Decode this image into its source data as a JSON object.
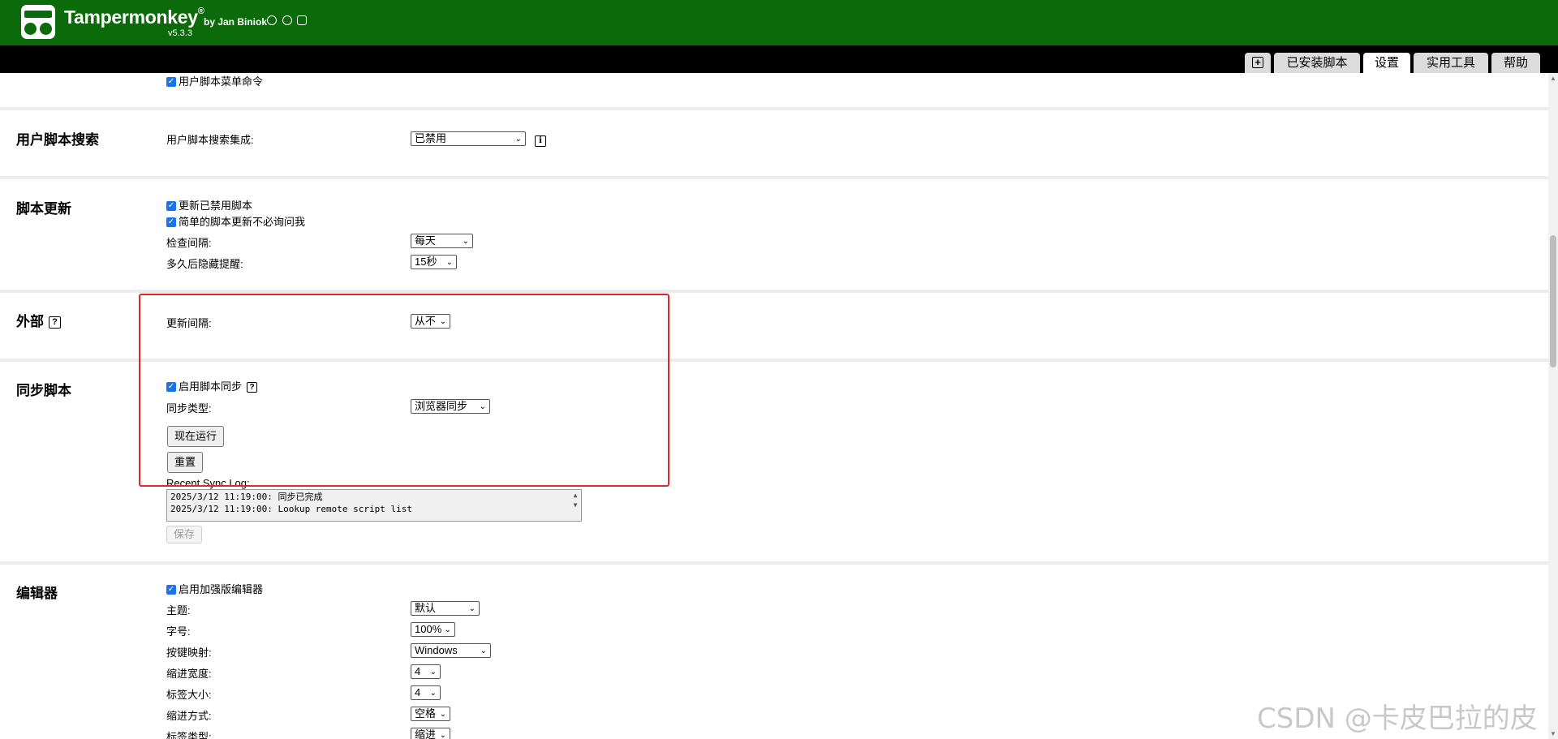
{
  "header": {
    "app_name": "Tampermonkey",
    "reg_mark": "®",
    "byline": "by Jan Biniok",
    "version": "v5.3.3"
  },
  "tabs": {
    "new_icon": "plus-square-icon",
    "installed": "已安装脚本",
    "settings": "设置",
    "utilities": "实用工具",
    "help": "帮助"
  },
  "top_row": {
    "menu_commands": "用户脚本菜单命令"
  },
  "search_section": {
    "title": "用户脚本搜索",
    "integration_label": "用户脚本搜索集成:",
    "integration_value": "已禁用"
  },
  "update_section": {
    "title": "脚本更新",
    "update_disabled": "更新已禁用脚本",
    "dont_ask": "简单的脚本更新不必询问我",
    "check_interval_label": "检查间隔:",
    "check_interval_value": "每天",
    "hide_after_label": "多久后隐藏提醒:",
    "hide_after_value": "15秒"
  },
  "external_section": {
    "title": "外部",
    "interval_label": "更新间隔:",
    "interval_value": "从不"
  },
  "sync_section": {
    "title": "同步脚本",
    "enable_sync": "启用脚本同步",
    "sync_type_label": "同步类型:",
    "sync_type_value": "浏览器同步",
    "run_now": "现在运行",
    "reset": "重置",
    "log_label": "Recent Sync Log:",
    "log_line1": "2025/3/12 11:19:00: 同步已完成",
    "log_line2": "2025/3/12 11:19:00: Lookup remote script list",
    "save": "保存"
  },
  "editor_section": {
    "title": "编辑器",
    "enable_enhanced": "启用加强版编辑器",
    "theme_label": "主题:",
    "theme_value": "默认",
    "font_size_label": "字号:",
    "font_size_value": "100%",
    "keymap_label": "按键映射:",
    "keymap_value": "Windows",
    "indent_width_label": "缩进宽度:",
    "indent_width_value": "4",
    "tab_size_label": "标签大小:",
    "tab_size_value": "4",
    "indent_mode_label": "缩进方式:",
    "indent_mode_value": "空格",
    "tab_type_label": "标签类型:",
    "tab_type_value": "缩进"
  },
  "watermark": "CSDN @卡皮巴拉的皮",
  "colors": {
    "header_bg": "#0b6b0b",
    "highlight": "#e2262b",
    "checkbox": "#1a73e8"
  }
}
